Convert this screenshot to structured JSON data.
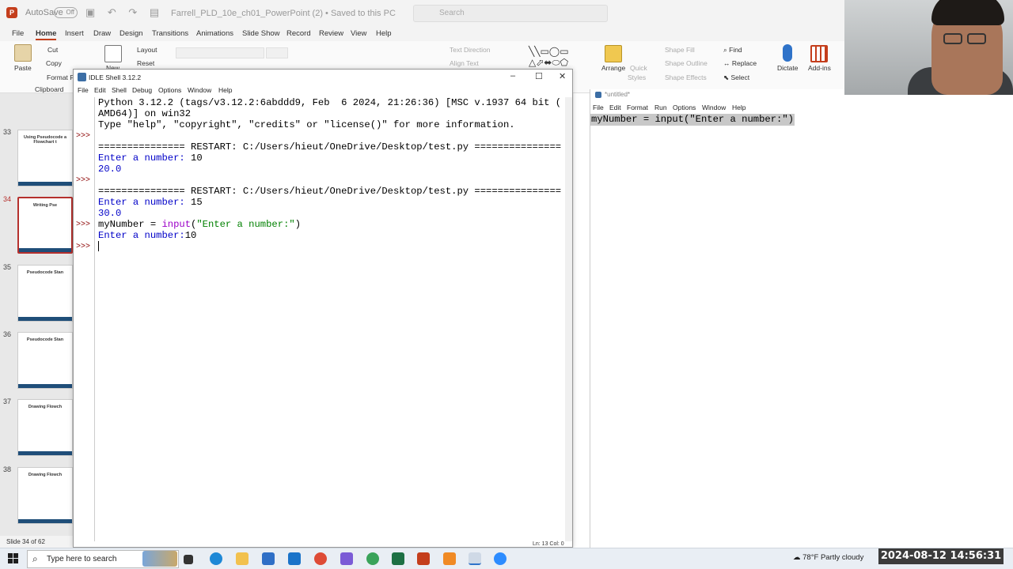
{
  "ppt": {
    "autosave_label": "AutoSave",
    "autosave_state": "Off",
    "doc_title": "Farrell_PLD_10e_ch01_PowerPoint (2) • Saved to this PC",
    "search_placeholder": "Search",
    "menu": [
      "File",
      "Home",
      "Insert",
      "Draw",
      "Design",
      "Transitions",
      "Animations",
      "Slide Show",
      "Record",
      "Review",
      "View",
      "Help"
    ],
    "ribbon": {
      "paste": "Paste",
      "cut": "Cut",
      "copy": "Copy",
      "format_painter": "Format Pa",
      "clipboard": "Clipboard",
      "new_slide": "New",
      "layout": "Layout",
      "reset": "Reset",
      "text_direction": "Text Direction",
      "align_text": "Align Text",
      "arrange": "Arrange",
      "quick_styles": "Quick",
      "quick_styles2": "Styles",
      "shape_fill": "Shape Fill",
      "shape_outline": "Shape Outline",
      "shape_effects": "Shape Effects",
      "find": "Find",
      "replace": "Replace",
      "select": "Select",
      "dictate": "Dictate",
      "addins": "Add-ins"
    },
    "thumbnails": [
      {
        "num": "33",
        "title": "Using Pseudocode a Flowchart t"
      },
      {
        "num": "34",
        "title": "Writing Pse"
      },
      {
        "num": "35",
        "title": "Pseudocode Stan"
      },
      {
        "num": "36",
        "title": "Pseudocode Stan"
      },
      {
        "num": "37",
        "title": "Drawing Flowch"
      },
      {
        "num": "38",
        "title": "Drawing Flowch"
      }
    ],
    "status": "Slide 34 of 62"
  },
  "idle_shell": {
    "title": "IDLE Shell 3.12.2",
    "menu": [
      "File",
      "Edit",
      "Shell",
      "Debug",
      "Options",
      "Window",
      "Help"
    ],
    "lines": {
      "l1": "Python 3.12.2 (tags/v3.12.2:6abddd9, Feb  6 2024, 21:26:36) [MSC v.1937 64 bit (",
      "l2": "AMD64)] on win32",
      "l3": "Type \"help\", \"copyright\", \"credits\" or \"license()\" for more information.",
      "l4": "=============== RESTART: C:/Users/hieut/OneDrive/Desktop/test.py ===============",
      "l5a": "Enter a number: ",
      "l5b": "10",
      "l6": "20.0",
      "l7": "=============== RESTART: C:/Users/hieut/OneDrive/Desktop/test.py ===============",
      "l8a": "Enter a number: ",
      "l8b": "15",
      "l9": "30.0",
      "l10a": "myNumber = ",
      "l10b": "input",
      "l10c": "(",
      "l10d": "\"Enter a number:\"",
      "l10e": ")",
      "l11a": "Enter a number:",
      "l11b": "10"
    },
    "prompt": ">>>",
    "status": "Ln: 13   Col: 0"
  },
  "editor": {
    "title": "*untitled*",
    "menu": [
      "File",
      "Edit",
      "Format",
      "Run",
      "Options",
      "Window",
      "Help"
    ],
    "code": "myNumber = input(\"Enter a number:\")"
  },
  "taskbar": {
    "search_placeholder": "Type here to search",
    "weather_temp": "78°F",
    "weather_text": "Partly cloudy",
    "clock": "2024-08-12 14:56:31"
  }
}
